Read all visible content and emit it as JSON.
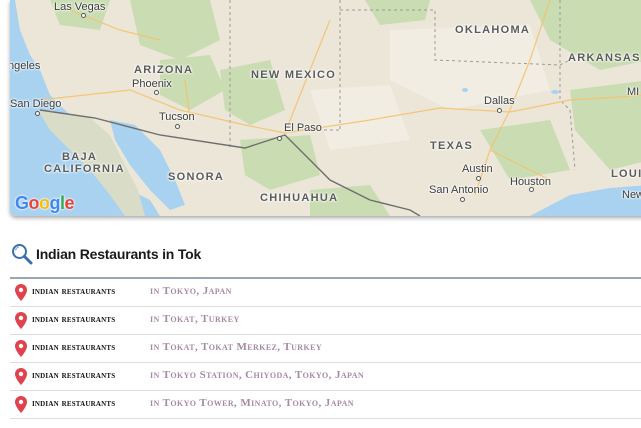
{
  "map": {
    "attribution": [
      "G",
      "o",
      "o",
      "g",
      "l",
      "e"
    ],
    "cities": [
      {
        "name": "Las Vegas"
      },
      {
        "name": "ngeles"
      },
      {
        "name": "San Diego"
      },
      {
        "name": "Phoenix"
      },
      {
        "name": "Tucson"
      },
      {
        "name": "El Paso"
      },
      {
        "name": "Dallas"
      },
      {
        "name": "Austin"
      },
      {
        "name": "San Antonio"
      },
      {
        "name": "Houston"
      },
      {
        "name": "New"
      },
      {
        "name": "MI"
      }
    ],
    "regions": [
      {
        "name": "ARIZONA"
      },
      {
        "name": "NEW MEXICO"
      },
      {
        "name": "OKLAHOMA"
      },
      {
        "name": "ARKANSAS"
      },
      {
        "name": "TEXAS"
      },
      {
        "name": "LOUISIAN"
      },
      {
        "name": "BAJA"
      },
      {
        "name": "CALIFORNIA"
      },
      {
        "name": "SONORA"
      },
      {
        "name": "CHIHUAHUA"
      }
    ]
  },
  "search": {
    "query": "Indian Restaurants in Tok"
  },
  "results": [
    {
      "name": "Indian Restaurants",
      "location": "in Tokyo, Japan"
    },
    {
      "name": "Indian Restaurants",
      "location": "in Tokat, Turkey"
    },
    {
      "name": "Indian Restaurants",
      "location": "in Tokat, Tokat Merkez, Turkey"
    },
    {
      "name": "Indian Restaurants",
      "location": "in Tokyo Station, Chiyoda, Tokyo, Japan"
    },
    {
      "name": "Indian Restaurants",
      "location": "in Tokyo Tower, Minato, Tokyo, Japan"
    }
  ],
  "colors": {
    "pin": "#e0434e",
    "location_text": "#a58aa3",
    "search_icon": "#3b6fb0",
    "water": "#a8d2f0",
    "land": "#ebe6d8",
    "vegetation": "#c3dbad"
  }
}
